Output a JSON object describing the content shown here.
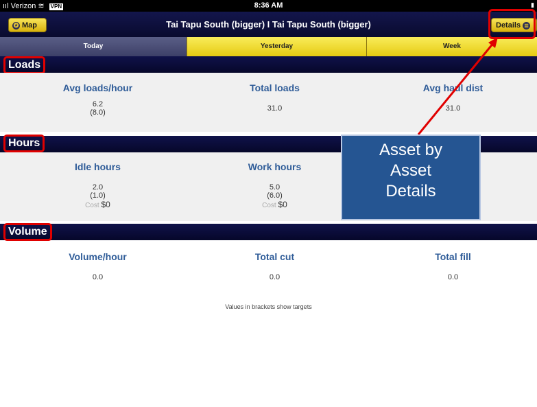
{
  "status_bar": {
    "carrier": "Verizon",
    "vpn": "VPN",
    "time": "8:36 AM"
  },
  "nav": {
    "title": "Tai Tapu South (bigger) I Tai Tapu South (bigger)",
    "map_button": "Map",
    "details_button": "Details"
  },
  "tabs": [
    {
      "label": "Today",
      "selected": true
    },
    {
      "label": "Yesterday",
      "selected": false
    },
    {
      "label": "Week",
      "selected": false
    }
  ],
  "sections": {
    "loads": {
      "title": "Loads",
      "metrics": [
        {
          "label": "Avg loads/hour",
          "value": "6.2",
          "target": "(8.0)"
        },
        {
          "label": "Total loads",
          "value": "31.0"
        },
        {
          "label": "Avg haul dist",
          "value": "31.0"
        }
      ]
    },
    "hours": {
      "title": "Hours",
      "metrics": [
        {
          "label": "Idle hours",
          "value": "2.0",
          "target": "(1.0)",
          "cost_label": "Cost",
          "cost": "$0"
        },
        {
          "label": "Work hours",
          "value": "5.0",
          "target": "(6.0)",
          "cost_label": "Cost",
          "cost": "$0"
        }
      ]
    },
    "volume": {
      "title": "Volume",
      "metrics": [
        {
          "label": "Volume/hour",
          "value": "0.0"
        },
        {
          "label": "Total cut",
          "value": "0.0"
        },
        {
          "label": "Total fill",
          "value": "0.0"
        }
      ]
    }
  },
  "footnote": "Values in brackets show targets",
  "callout": {
    "line1": "Asset by",
    "line2": "Asset",
    "line3": "Details"
  },
  "colors": {
    "navbar": "#0d0f3e",
    "tab_accent": "#f2dc2e",
    "metric_heading": "#2f5c98",
    "callout_bg": "#255592",
    "annotation_red": "#e00000"
  }
}
